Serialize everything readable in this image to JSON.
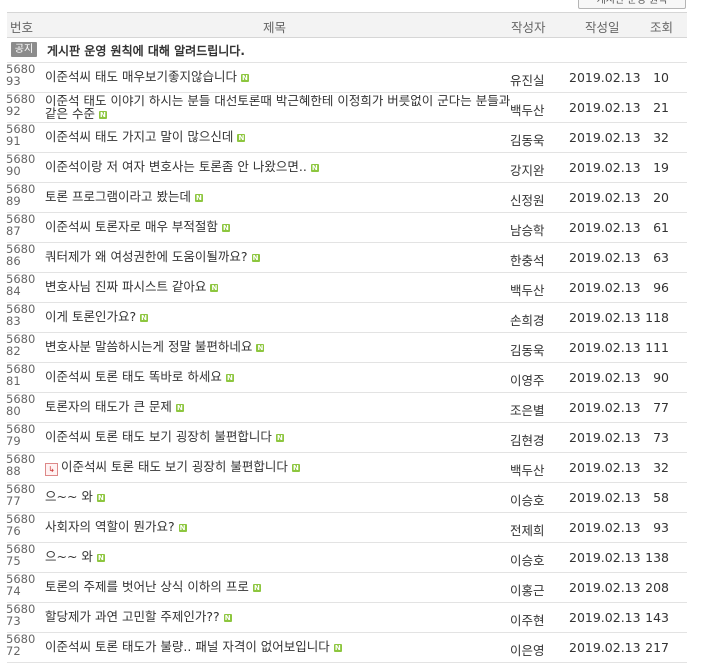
{
  "top_button": "게시판 운영 원칙",
  "header": {
    "no": "번호",
    "title": "제목",
    "author": "작성자",
    "date": "작성일",
    "views": "조회"
  },
  "notice": {
    "badge": "공지",
    "title": "게시판 운영 원칙에 대해 알려드립니다."
  },
  "posts": [
    {
      "no": "568093",
      "title": "이준석씨 태도 매우보기좋지않습니다",
      "author": "유진실",
      "date": "2019.02.13",
      "views": "10",
      "is_new": true
    },
    {
      "no": "568092",
      "title": "이준석 태도 이야기 하시는 분들 대선토론때 박근혜한테 이정희가 버릇없이 군다는 분들과 같은 수준",
      "author": "백두산",
      "date": "2019.02.13",
      "views": "21",
      "is_new": true,
      "wrap": true
    },
    {
      "no": "568091",
      "title": "이준석씨 태도 가지고 말이 많으신데",
      "author": "김동욱",
      "date": "2019.02.13",
      "views": "32",
      "is_new": true
    },
    {
      "no": "568090",
      "title": "이준석이랑 저 여자 변호사는 토론좀 안 나왔으면..",
      "author": "강지완",
      "date": "2019.02.13",
      "views": "19",
      "is_new": true
    },
    {
      "no": "568089",
      "title": "토론 프로그램이라고 봤는데",
      "author": "신정원",
      "date": "2019.02.13",
      "views": "20",
      "is_new": true
    },
    {
      "no": "568087",
      "title": "이준석씨 토론자로 매우 부적절함",
      "author": "남승학",
      "date": "2019.02.13",
      "views": "61",
      "is_new": true
    },
    {
      "no": "568086",
      "title": "쿼터제가 왜 여성권한에 도움이될까요?",
      "author": "한충석",
      "date": "2019.02.13",
      "views": "63",
      "is_new": true
    },
    {
      "no": "568084",
      "title": "변호사님 진짜 파시스트 같아요",
      "author": "백두산",
      "date": "2019.02.13",
      "views": "96",
      "is_new": true
    },
    {
      "no": "568083",
      "title": "이게 토론인가요?",
      "author": "손희경",
      "date": "2019.02.13",
      "views": "118",
      "is_new": true
    },
    {
      "no": "568082",
      "title": "변호사분 말씀하시는게 정말 불편하네요",
      "author": "김동욱",
      "date": "2019.02.13",
      "views": "111",
      "is_new": true
    },
    {
      "no": "568081",
      "title": "이준석씨 토론 태도 똑바로 하세요",
      "author": "이영주",
      "date": "2019.02.13",
      "views": "90",
      "is_new": true
    },
    {
      "no": "568080",
      "title": "토론자의 태도가 큰 문제",
      "author": "조은별",
      "date": "2019.02.13",
      "views": "77",
      "is_new": true
    },
    {
      "no": "568079",
      "title": "이준석씨 토론 태도 보기 굉장히 불편합니다",
      "author": "김현경",
      "date": "2019.02.13",
      "views": "73",
      "is_new": true
    },
    {
      "no": "568088",
      "title": "이준석씨 토론 태도 보기 굉장히 불편합니다",
      "author": "백두산",
      "date": "2019.02.13",
      "views": "32",
      "is_new": true,
      "reply": true
    },
    {
      "no": "568077",
      "title": "으~~ 와",
      "author": "이승호",
      "date": "2019.02.13",
      "views": "58",
      "is_new": true
    },
    {
      "no": "568076",
      "title": "사회자의 역할이 뭔가요?",
      "author": "전제희",
      "date": "2019.02.13",
      "views": "93",
      "is_new": true
    },
    {
      "no": "568075",
      "title": "으~~ 와",
      "author": "이승호",
      "date": "2019.02.13",
      "views": "138",
      "is_new": true
    },
    {
      "no": "568074",
      "title": "토론의 주제를 벗어난 상식 이하의 프로",
      "author": "이홍근",
      "date": "2019.02.13",
      "views": "208",
      "is_new": true
    },
    {
      "no": "568073",
      "title": "할당제가 과연 고민할 주제인가??",
      "author": "이주현",
      "date": "2019.02.13",
      "views": "143",
      "is_new": true
    },
    {
      "no": "568072",
      "title": "이준석씨 토론 태도가 불량.. 패널 자격이 없어보입니다",
      "author": "이은영",
      "date": "2019.02.13",
      "views": "217",
      "is_new": true
    }
  ]
}
